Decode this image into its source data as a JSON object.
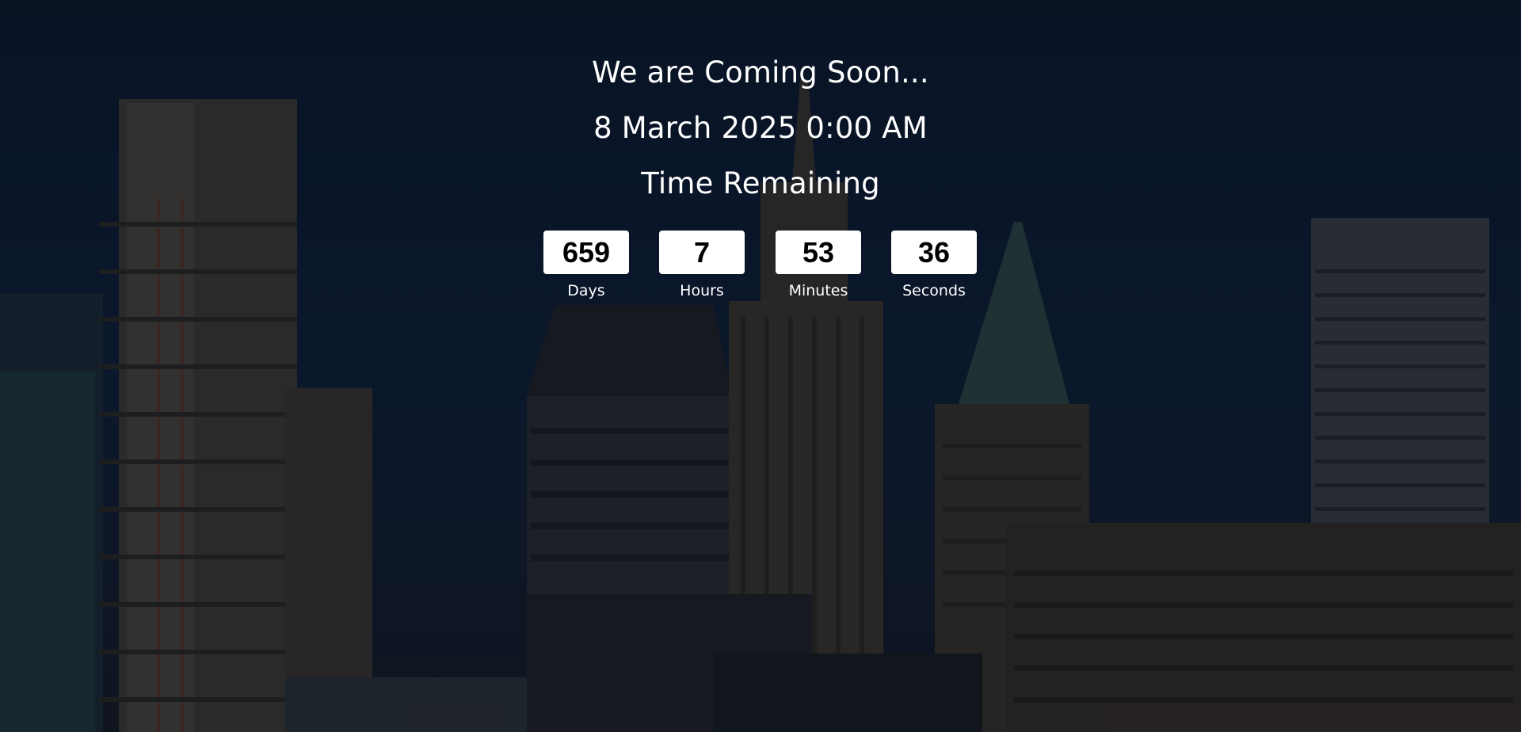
{
  "hero": {
    "title": "We are Coming Soon...",
    "launch_date": "8 March 2025 0:00 AM",
    "subtitle": "Time Remaining"
  },
  "countdown": [
    {
      "value": "659",
      "label": "Days"
    },
    {
      "value": "7",
      "label": "Hours"
    },
    {
      "value": "53",
      "label": "Minutes"
    },
    {
      "value": "36",
      "label": "Seconds"
    }
  ],
  "colors": {
    "background": "#0b1628",
    "text": "#ffffff",
    "box": "#ffffff",
    "box_text": "#000000"
  },
  "background_image": "city-skyline-at-dusk"
}
